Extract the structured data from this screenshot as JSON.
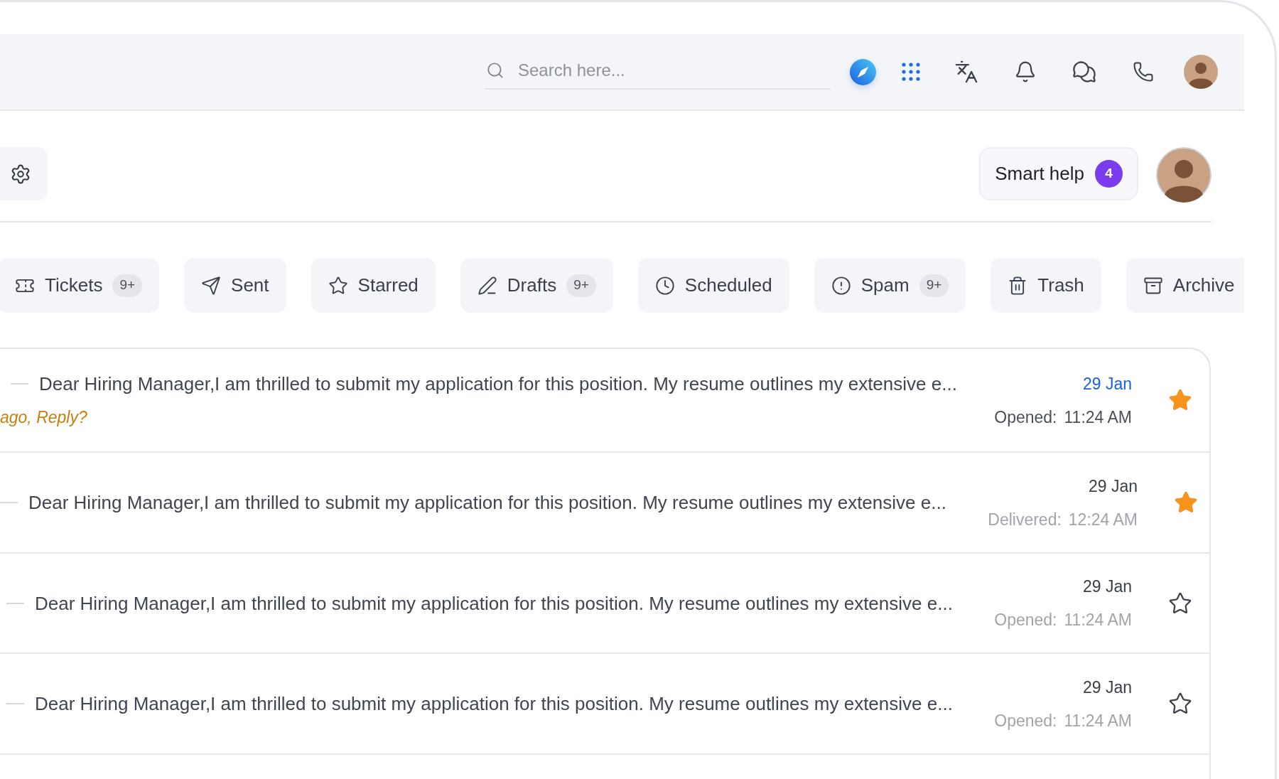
{
  "search": {
    "placeholder": "Search here..."
  },
  "smart_help": {
    "label": "Smart help",
    "count": "4"
  },
  "folders": [
    {
      "label": "Tickets",
      "badge": "9+",
      "selected": false
    },
    {
      "label": "Sent",
      "selected": false
    },
    {
      "label": "Starred",
      "selected": false
    },
    {
      "label": "Drafts",
      "badge": "9+",
      "selected": false
    },
    {
      "label": "Scheduled",
      "selected": false
    },
    {
      "label": "Spam",
      "badge": "9+",
      "selected": false
    },
    {
      "label": "Trash",
      "selected": false
    },
    {
      "label": "Archive",
      "selected": false
    }
  ],
  "messages": [
    {
      "preview": "Dear Hiring Manager,I am thrilled to submit my application for this position. My resume outlines my extensive e...",
      "reminder": "ago, Reply?",
      "date": "29 Jan",
      "status": "Opened:",
      "time": "11:24 AM",
      "unread": true,
      "starred": true
    },
    {
      "preview": "Dear Hiring Manager,I am thrilled to submit my application for this position. My resume outlines my extensive e...",
      "date": "29 Jan",
      "status": "Delivered:",
      "time": "12:24 AM",
      "unread": false,
      "starred": true
    },
    {
      "preview": "Dear Hiring Manager,I am thrilled to submit my application for this position. My resume outlines my extensive e...",
      "date": "29 Jan",
      "status": "Opened:",
      "time": "11:24 AM",
      "unread": false,
      "starred": false
    },
    {
      "preview": "Dear Hiring Manager,I am thrilled to submit my application for this position. My resume outlines my extensive e...",
      "date": "29 Jan",
      "status": "Opened:",
      "time": "11:24 AM",
      "unread": false,
      "starred": false
    }
  ]
}
